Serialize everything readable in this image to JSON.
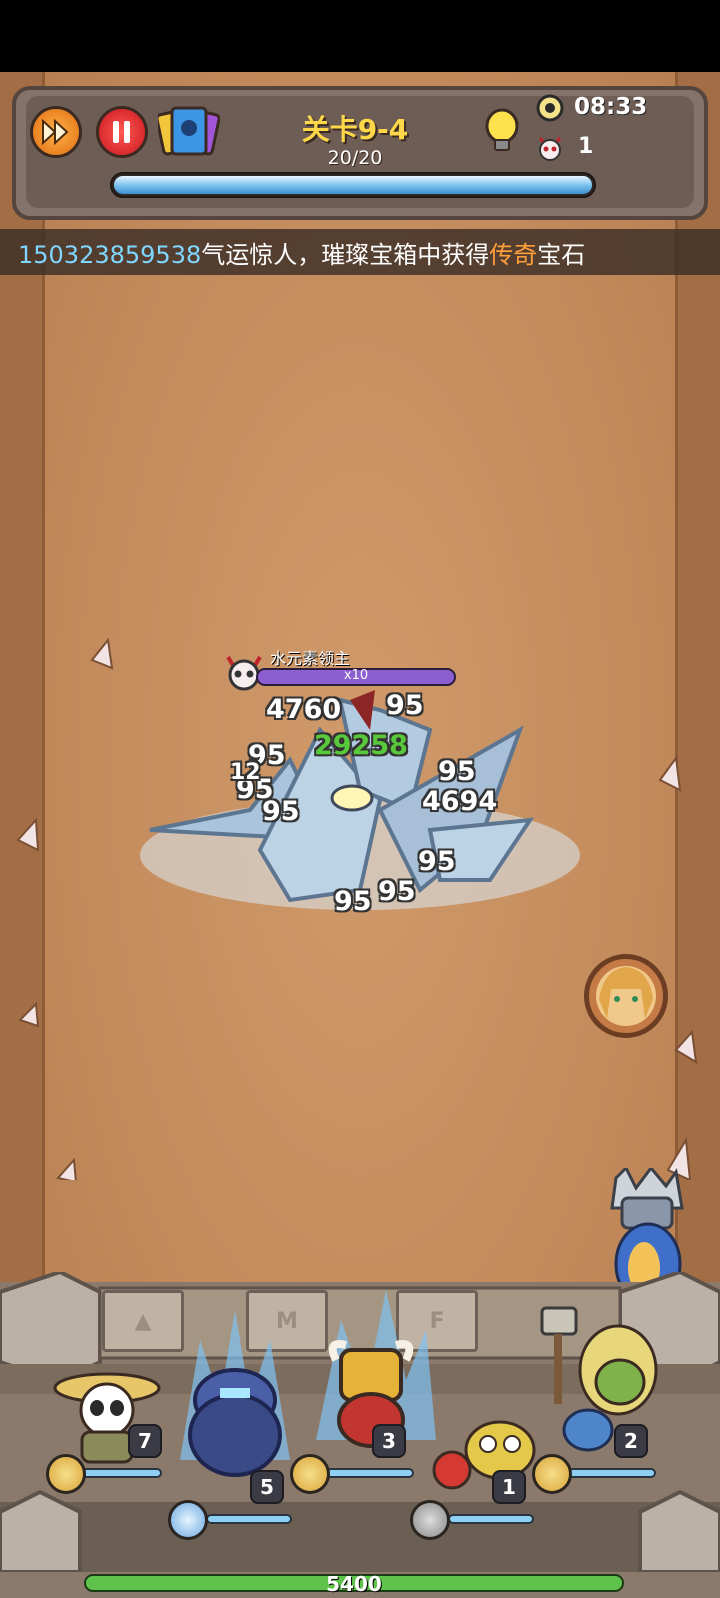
{
  "hud": {
    "stage_title": "关卡9-4",
    "wave_progress": "20/20",
    "wave_fraction": 1.0,
    "timer": "08:33",
    "kill_count": "1",
    "icons": [
      "fast-forward-icon",
      "pause-icon",
      "card-deck-icon",
      "lightbulb-hint-icon",
      "clock-icon",
      "demon-skull-icon"
    ]
  },
  "ticker": {
    "uid": "150323859538",
    "text_before": "气运惊人，璀璨宝箱中获得",
    "highlight": "传奇",
    "text_after": "宝石"
  },
  "boss": {
    "name": "水元素领主",
    "multiplier": "x10",
    "bar_color": "#8b5fcf"
  },
  "damage_numbers": [
    "4760",
    "95",
    "29258",
    "95",
    "95",
    "95",
    "4694",
    "95",
    "95",
    "95",
    "95",
    "95",
    "12"
  ],
  "heroes": [
    {
      "name": "panda",
      "level": "7"
    },
    {
      "name": "ice-knight",
      "level": "5"
    },
    {
      "name": "minotaur-warrior",
      "level": "3"
    },
    {
      "name": "goblin-bomber",
      "level": "1"
    },
    {
      "name": "orc-hammer",
      "level": "2"
    }
  ],
  "base_hp": "5400",
  "colors": {
    "accent_yellow": "#ffd84a",
    "ticker_uid": "#7fd6ff",
    "ticker_highlight": "#ffa03c",
    "hp_green": "#5fc24a",
    "crit_green": "#58c93a"
  }
}
